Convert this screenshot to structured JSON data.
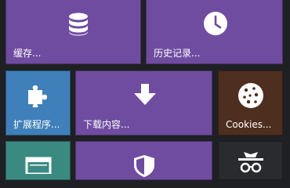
{
  "colors": {
    "background": "#1f2023",
    "purple": "#6f4ca0",
    "blue": "#3f7fba",
    "brown": "#4e2e1f",
    "teal": "#3a8a82",
    "dark": "#2a2b2e",
    "icon": "#ffffff"
  },
  "tiles": [
    {
      "id": "cache",
      "label": "缓存...",
      "icon": "database-icon",
      "color": "purple"
    },
    {
      "id": "history",
      "label": "历史记录...",
      "icon": "clock-icon",
      "color": "purple"
    },
    {
      "id": "extensions",
      "label": "扩展程序...",
      "icon": "puzzle-icon",
      "color": "blue"
    },
    {
      "id": "downloads",
      "label": "下载内容...",
      "icon": "download-arrow-icon",
      "color": "purple"
    },
    {
      "id": "cookies",
      "label": "Cookies...",
      "icon": "cookie-icon",
      "color": "brown"
    },
    {
      "id": "fullscreen",
      "label": "",
      "icon": "window-icon",
      "color": "teal"
    },
    {
      "id": "security",
      "label": "",
      "icon": "shield-icon",
      "color": "purple"
    },
    {
      "id": "incognito",
      "label": "",
      "icon": "incognito-icon",
      "color": "dark"
    }
  ]
}
